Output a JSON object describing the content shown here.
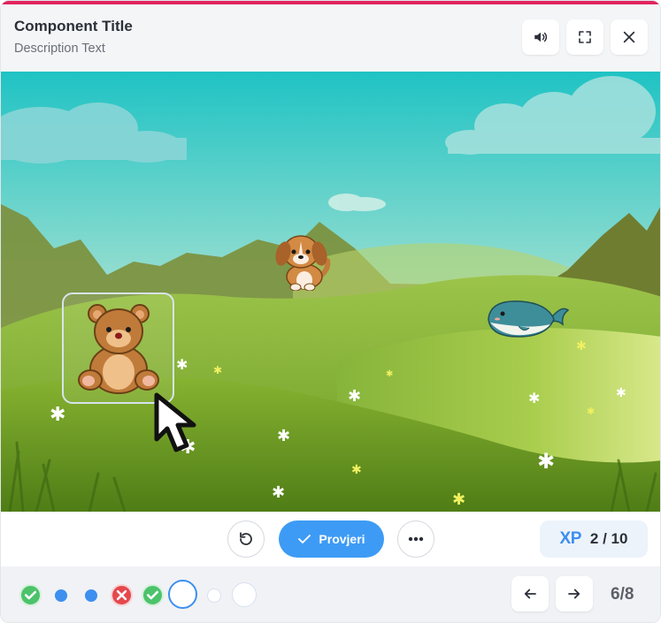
{
  "header": {
    "title": "Component Title",
    "description": "Description Text",
    "buttons": [
      {
        "name": "sound",
        "icon": "speaker-icon"
      },
      {
        "name": "fullscreen",
        "icon": "fullscreen-icon"
      },
      {
        "name": "close",
        "icon": "close-icon"
      }
    ]
  },
  "scene": {
    "animals": [
      {
        "name": "bear",
        "selected": true
      },
      {
        "name": "puppy",
        "selected": false
      },
      {
        "name": "whale",
        "selected": false
      }
    ],
    "cursor_icon": "pointer-cursor-icon"
  },
  "controls": {
    "reset_icon": "rotate-ccw-icon",
    "check_label": "Provjeri",
    "check_icon": "checkmark-icon",
    "more_icon": "more-dots-icon",
    "xp_label": "XP",
    "xp_value": "2 / 10"
  },
  "progress": {
    "steps": [
      "correct",
      "pending-dot",
      "pending-dot",
      "wrong",
      "correct",
      "current",
      "empty-small",
      "empty"
    ],
    "page_counter": "6/8"
  },
  "colors": {
    "accent": "#e0245e",
    "primary": "#3d9bf5",
    "correct": "#4cc36a",
    "wrong": "#e5484d"
  }
}
